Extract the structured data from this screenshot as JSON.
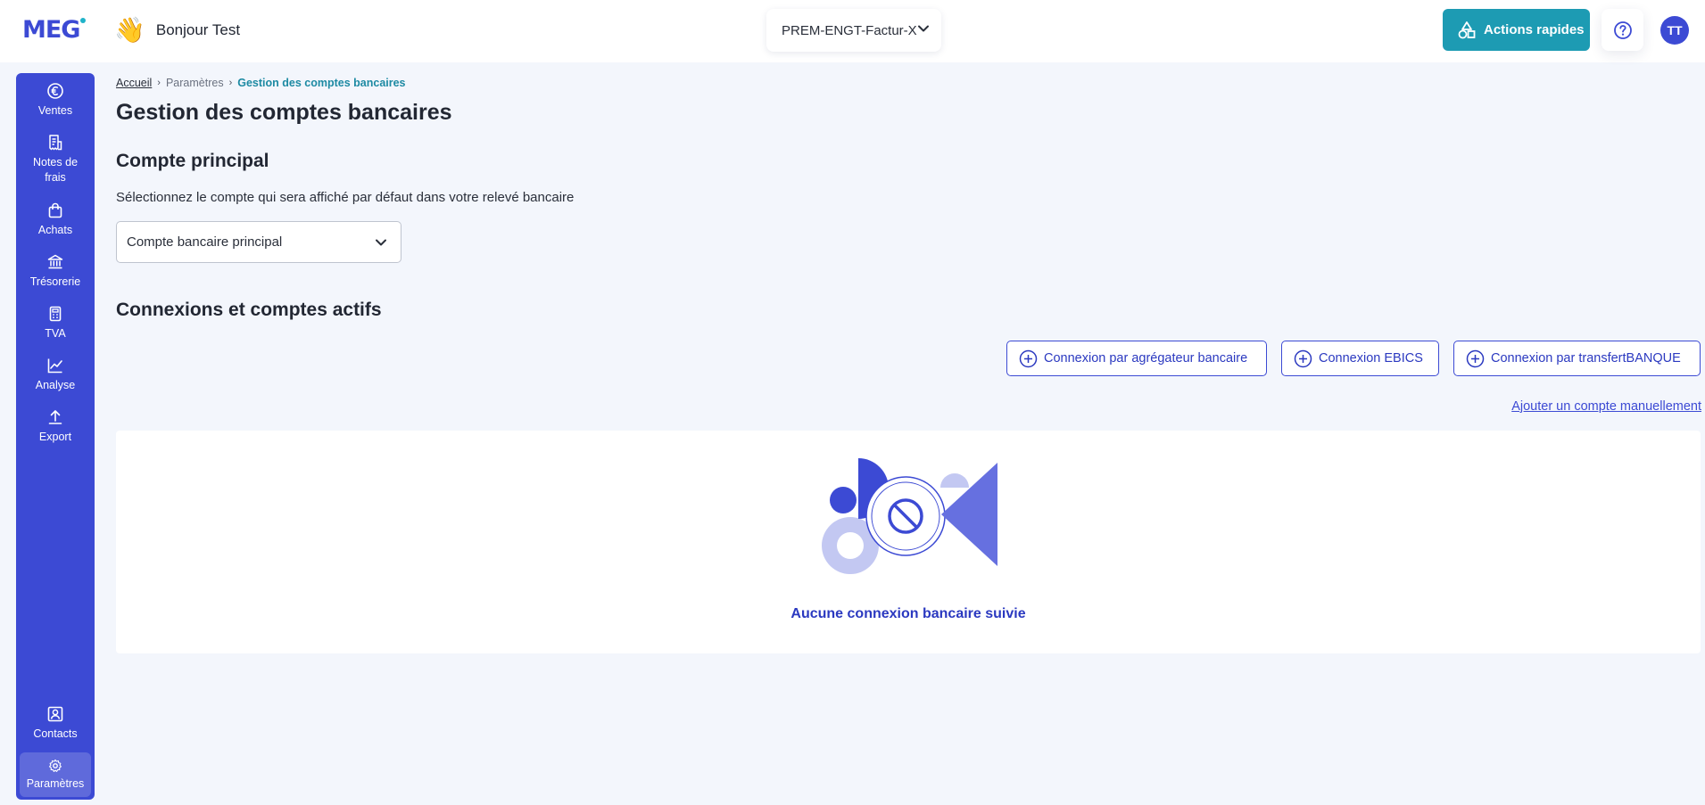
{
  "header": {
    "logo": "MEG",
    "greeting": "Bonjour Test",
    "company_selector": "PREM-ENGT-Factur-X",
    "quick_actions_label": "Actions rapides",
    "avatar_initials": "TT"
  },
  "sidebar": {
    "items": [
      {
        "label": "Ventes",
        "icon": "euro-icon"
      },
      {
        "label": "Notes de frais",
        "icon": "receipt-icon"
      },
      {
        "label": "Achats",
        "icon": "shopping-bag-icon"
      },
      {
        "label": "Trésorerie",
        "icon": "bank-icon"
      },
      {
        "label": "TVA",
        "icon": "calculator-icon"
      },
      {
        "label": "Analyse",
        "icon": "chart-line-icon"
      },
      {
        "label": "Export",
        "icon": "upload-icon"
      }
    ],
    "bottom_items": [
      {
        "label": "Contacts",
        "icon": "contact-card-icon"
      },
      {
        "label": "Paramètres",
        "icon": "gear-icon",
        "active": true
      }
    ]
  },
  "breadcrumb": {
    "home": "Accueil",
    "parent": "Paramètres",
    "current": "Gestion des comptes bancaires"
  },
  "page": {
    "title": "Gestion des comptes bancaires",
    "main_account": {
      "heading": "Compte principal",
      "description": "Sélectionnez le compte qui sera affiché par défaut dans votre relevé bancaire",
      "selected": "Compte bancaire principal"
    },
    "connections": {
      "heading": "Connexions et comptes actifs",
      "buttons": {
        "aggregator": "Connexion par agrégateur bancaire",
        "ebics": "Connexion EBICS",
        "transfert": "Connexion par transfertBANQUE"
      },
      "manual_link": "Ajouter un compte manuellement",
      "empty_message": "Aucune connexion bancaire suivie"
    }
  },
  "colors": {
    "primary": "#3c4ad4",
    "teal": "#1d9bb3",
    "background": "#f3f6fc"
  }
}
